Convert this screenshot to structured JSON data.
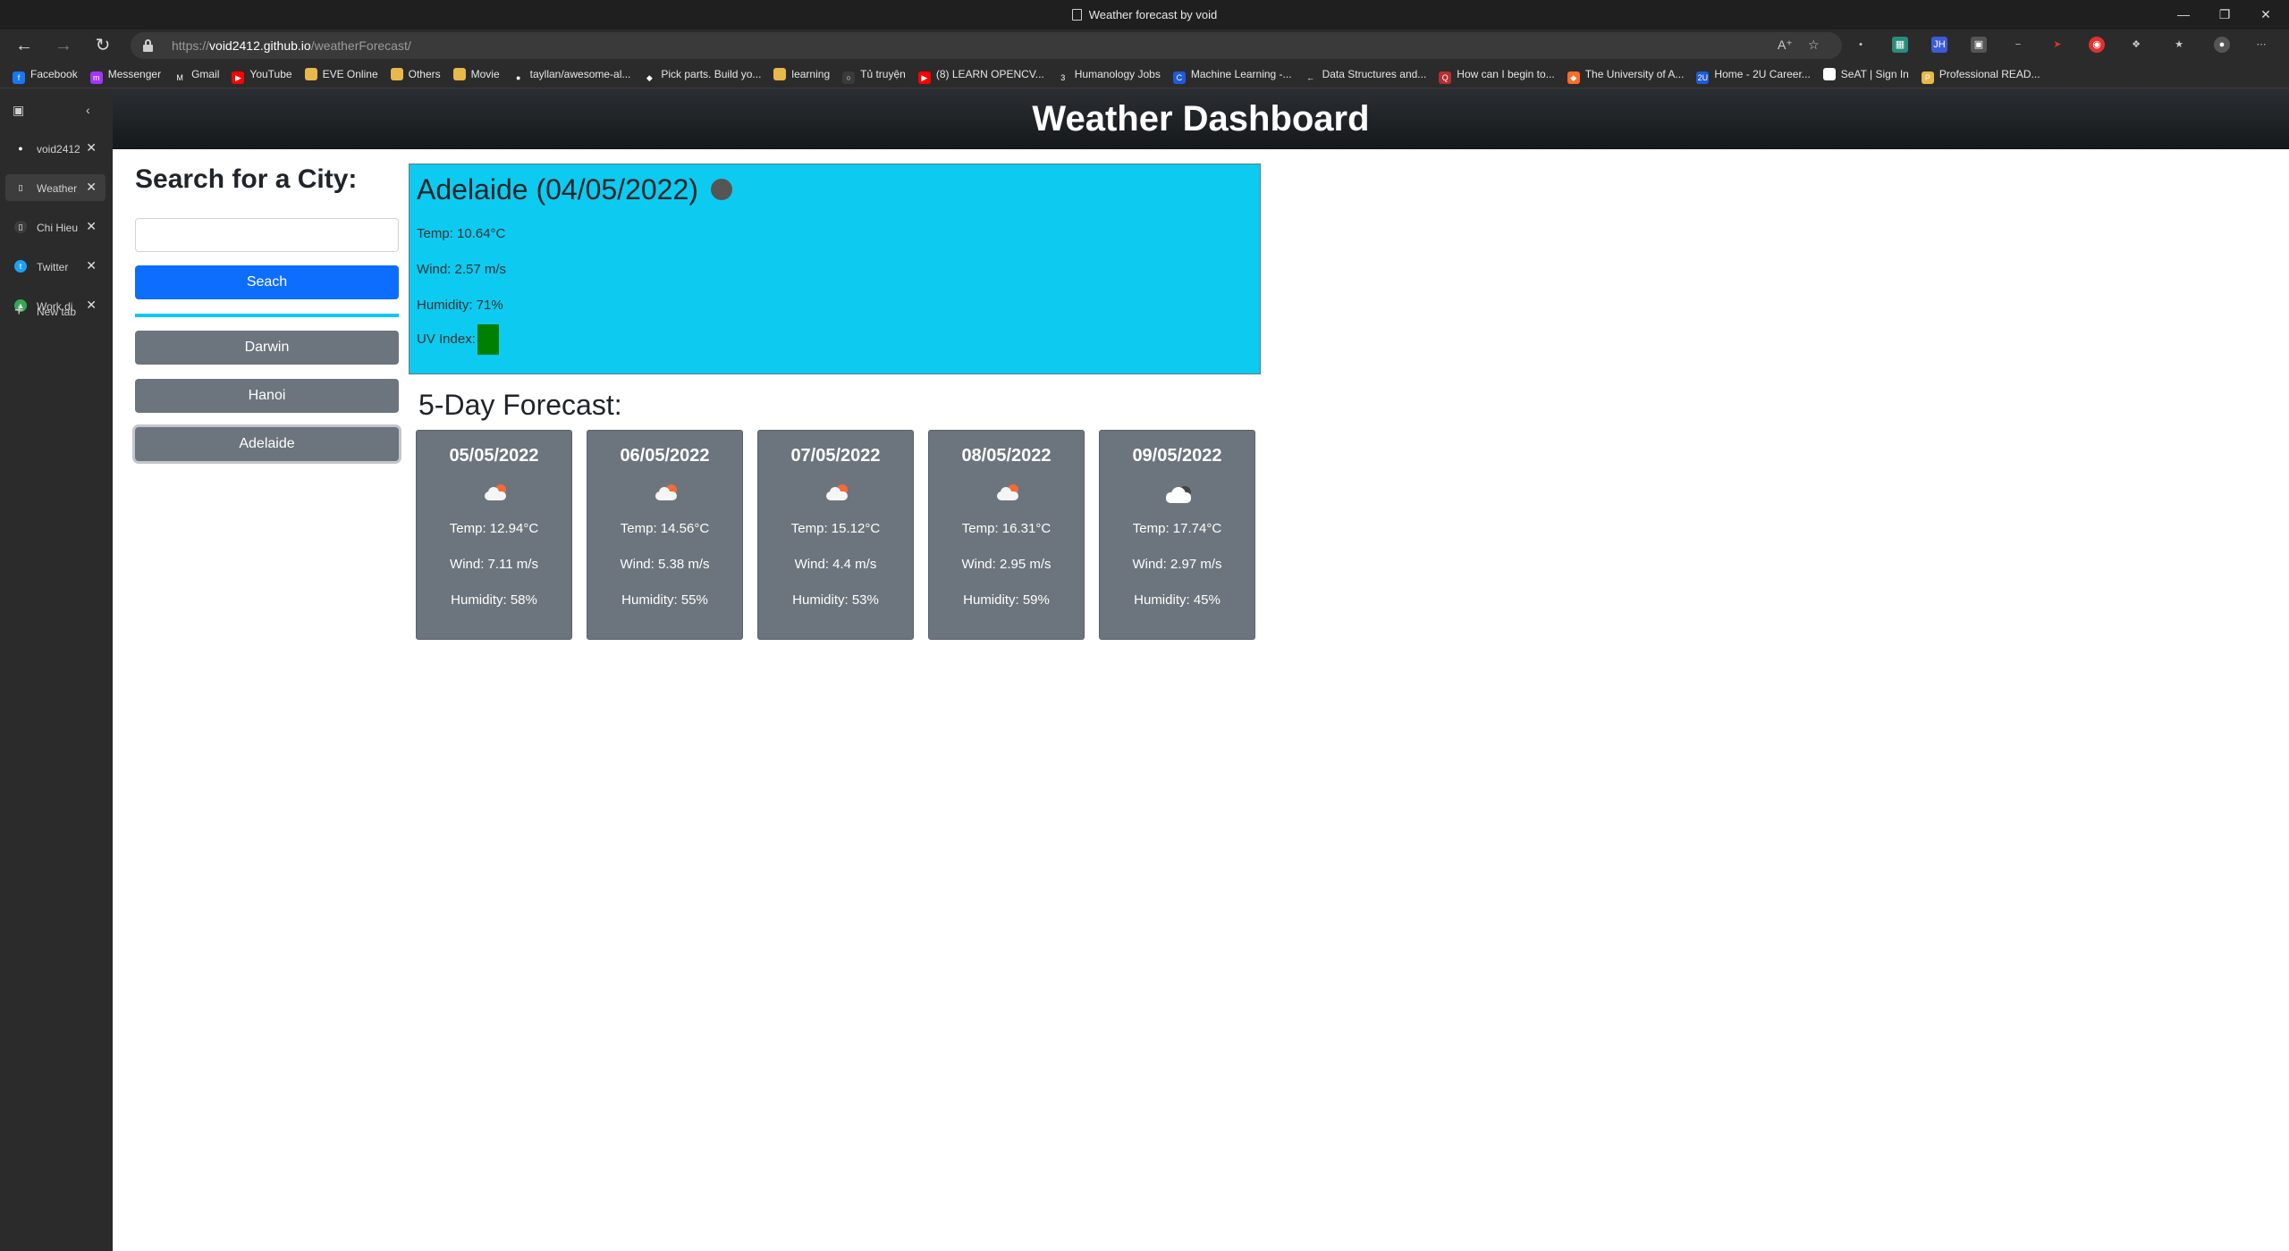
{
  "browser": {
    "window_title": "Weather forecast by void",
    "url_prefix": "https://",
    "url_host": "void2412.github.io",
    "url_path": "/weatherForecast/",
    "bookmarks": [
      {
        "label": "Facebook",
        "color": "#1877f2",
        "glyph": "f"
      },
      {
        "label": "Messenger",
        "color": "#a334fa",
        "glyph": "m"
      },
      {
        "label": "Gmail",
        "color": "#2b2b2b",
        "glyph": "M"
      },
      {
        "label": "YouTube",
        "color": "#ff0000",
        "glyph": "▶"
      },
      {
        "label": "EVE Online",
        "color": "#e8b84a",
        "glyph": ""
      },
      {
        "label": "Others",
        "color": "#e8b84a",
        "glyph": ""
      },
      {
        "label": "Movie",
        "color": "#e8b84a",
        "glyph": ""
      },
      {
        "label": "tayllan/awesome-al...",
        "color": "#2b2b2b",
        "glyph": "●"
      },
      {
        "label": "Pick parts. Build yo...",
        "color": "#2b2b2b",
        "glyph": "◆"
      },
      {
        "label": "learning",
        "color": "#e8b84a",
        "glyph": ""
      },
      {
        "label": "Tủ truyện",
        "color": "#3a3a3a",
        "glyph": "○"
      },
      {
        "label": "(8) LEARN OPENCV...",
        "color": "#ff0000",
        "glyph": "▶"
      },
      {
        "label": "Humanology Jobs",
        "color": "#2b2b2b",
        "glyph": "3"
      },
      {
        "label": "Machine Learning -...",
        "color": "#1e5bd6",
        "glyph": "C"
      },
      {
        "label": "Data Structures and...",
        "color": "#2b2b2b",
        "glyph": "←"
      },
      {
        "label": "How can I begin to...",
        "color": "#b52e31",
        "glyph": "Q"
      },
      {
        "label": "The University of A...",
        "color": "#fc6d26",
        "glyph": "◆"
      },
      {
        "label": "Home - 2U Career...",
        "color": "#1e5bd6",
        "glyph": "2U"
      },
      {
        "label": "SeAT | Sign In",
        "color": "#ffffff",
        "glyph": ""
      },
      {
        "label": "Professional READ...",
        "color": "#e8b84a",
        "glyph": "P"
      }
    ],
    "tabs": [
      {
        "label": "void2412",
        "color": "#2b2b2b",
        "glyph": "●",
        "active": false
      },
      {
        "label": "Weather",
        "color": "#3d3d3d",
        "glyph": "▯",
        "active": true
      },
      {
        "label": "Chi Hieu",
        "color": "#3d3d3d",
        "glyph": "▯",
        "active": false
      },
      {
        "label": "Twitter",
        "color": "#1da1f2",
        "glyph": "t",
        "active": false
      },
      {
        "label": "Work di",
        "color": "#34a853",
        "glyph": "▲",
        "active": false
      }
    ],
    "new_tab_label": "New tab"
  },
  "page": {
    "header_title": "Weather Dashboard",
    "search_heading": "Search for a City:",
    "search_input_value": "",
    "search_button_label": "Seach",
    "history": [
      "Darwin",
      "Hanoi",
      "Adelaide"
    ],
    "selected_city": "Adelaide"
  },
  "current": {
    "city_date": "Adelaide (04/05/2022)",
    "temp": "Temp: 10.64°C",
    "wind": "Wind: 2.57 m/s",
    "humidity": "Humidity: 71%",
    "uv_label": "UV Index:",
    "uv_value": "0",
    "uv_color": "#008000"
  },
  "forecast": {
    "title": "5-Day Forecast:",
    "days": [
      {
        "date": "05/05/2022",
        "icon": "partly-cloudy-icon",
        "temp": "Temp: 12.94°C",
        "wind": "Wind: 7.11 m/s",
        "humidity": "Humidity: 58%"
      },
      {
        "date": "06/05/2022",
        "icon": "partly-cloudy-icon",
        "temp": "Temp: 14.56°C",
        "wind": "Wind: 5.38 m/s",
        "humidity": "Humidity: 55%"
      },
      {
        "date": "07/05/2022",
        "icon": "partly-cloudy-icon",
        "temp": "Temp: 15.12°C",
        "wind": "Wind: 4.4 m/s",
        "humidity": "Humidity: 53%"
      },
      {
        "date": "08/05/2022",
        "icon": "partly-cloudy-icon",
        "temp": "Temp: 16.31°C",
        "wind": "Wind: 2.95 m/s",
        "humidity": "Humidity: 59%"
      },
      {
        "date": "09/05/2022",
        "icon": "cloudy-icon",
        "temp": "Temp: 17.74°C",
        "wind": "Wind: 2.97 m/s",
        "humidity": "Humidity: 45%"
      }
    ]
  },
  "colors": {
    "header_bg": "#212529",
    "primary": "#0d6efd",
    "info": "#0dcaf0",
    "secondary": "#6c757d"
  }
}
